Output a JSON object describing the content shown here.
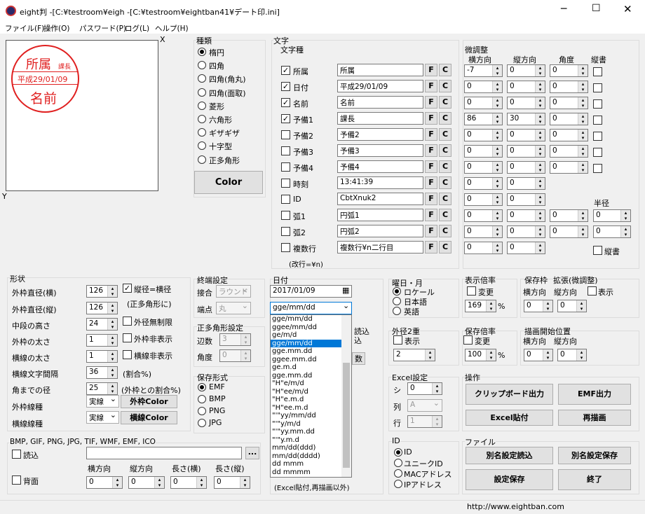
{
  "window": {
    "title": "eight判 -[C:¥testroom¥eigh -[C:¥testroom¥eightban41¥デート印.ini]"
  },
  "menu": [
    "ファイル(F)",
    "操作(O)",
    "パスワード(P)",
    "ログ(L)",
    "ヘルプ(H)"
  ],
  "canvas": {
    "x_label": "X",
    "y_label": "Y",
    "stamp": {
      "top": "所属",
      "badge": "課長",
      "date": "平成29/01/09",
      "name": "名前",
      "color": "#e02020"
    }
  },
  "shape": {
    "title": "種類",
    "options": [
      "楕円",
      "四角",
      "四角(角丸)",
      "四角(面取)",
      "菱形",
      "六角形",
      "ギザギザ",
      "十字型",
      "正多角形"
    ],
    "selected": 0,
    "color_button": "Color"
  },
  "text": {
    "title": "文字",
    "subtitle": "文字種",
    "note": "(改行=¥n)",
    "rows": [
      {
        "label": "所属",
        "checked": true,
        "value": "所属"
      },
      {
        "label": "日付",
        "checked": true,
        "value": "平成29/01/09"
      },
      {
        "label": "名前",
        "checked": true,
        "value": "名前"
      },
      {
        "label": "予備1",
        "checked": true,
        "value": "課長"
      },
      {
        "label": "予備2",
        "checked": false,
        "value": "予備2"
      },
      {
        "label": "予備3",
        "checked": false,
        "value": "予備3"
      },
      {
        "label": "予備4",
        "checked": false,
        "value": "予備4"
      },
      {
        "label": "時刻",
        "checked": false,
        "value": "13:41:39"
      },
      {
        "label": "ID",
        "checked": false,
        "value": "CbtXnuk2"
      },
      {
        "label": "弧1",
        "checked": false,
        "value": "円弧1"
      },
      {
        "label": "弧2",
        "checked": false,
        "value": "円弧2"
      },
      {
        "label": "複数行",
        "checked": false,
        "value": "複数行¥n二行目"
      }
    ],
    "f_label": "F",
    "c_label": "C"
  },
  "fine": {
    "title": "微調整",
    "headers": [
      "横方向",
      "縦方向",
      "角度",
      "縦書"
    ],
    "radius_label": "半径",
    "vertical_label": "縦書",
    "rows": [
      [
        "-7",
        "0",
        "0"
      ],
      [
        "0",
        "0",
        "0"
      ],
      [
        "0",
        "0",
        "0"
      ],
      [
        "86",
        "30",
        "0"
      ],
      [
        "0",
        "0",
        "0"
      ],
      [
        "0",
        "0",
        "0"
      ],
      [
        "0",
        "0",
        "0"
      ],
      [
        "0",
        "0",
        ""
      ],
      [
        "0",
        "0",
        ""
      ],
      [
        "0",
        "0",
        "0",
        "0"
      ],
      [
        "0",
        "0",
        "0",
        "0"
      ],
      [
        "0",
        "0",
        ""
      ]
    ]
  },
  "form": {
    "title": "形状",
    "labels": [
      "外枠直径(横)",
      "外枠直径(縦)",
      "中段の高さ",
      "外枠の太さ",
      "横線の太さ",
      "横線文字間隔",
      "角までの径",
      "外枠線種",
      "横線線種"
    ],
    "values": [
      "126",
      "126",
      "24",
      "1",
      "1",
      "36",
      "25"
    ],
    "line1": "実線",
    "line2": "実線",
    "checks": [
      "縦径=横径",
      "外径無制限",
      "外枠非表示",
      "横線非表示"
    ],
    "note1": "(正多角形に)",
    "note2": "(割合%)",
    "note3": "(外枠との割合%)",
    "btn_outer": "外枠Color",
    "btn_line": "横線Color"
  },
  "end": {
    "title": "終端設定",
    "join_label": "接合",
    "join_val": "ラウンド",
    "cap_label": "端点",
    "cap_val": "丸"
  },
  "poly": {
    "title": "正多角形設定",
    "sides_label": "辺数",
    "sides": "3",
    "angle_label": "角度",
    "angle": "0"
  },
  "save": {
    "title": "保存形式",
    "options": [
      "EMF",
      "BMP",
      "PNG",
      "JPG"
    ],
    "selected": 0
  },
  "date": {
    "title": "日付",
    "value": "2017/01/09",
    "format": "gge/mm/dd",
    "list": [
      "gge/mm/dd",
      "ggee/mm/dd",
      "ge/m/d",
      "gge/mm/dd",
      "gge.mm.dd",
      "ggee.mm.dd",
      "ge.m.d",
      "gge.mm.dd",
      "\"H\"e/m/d",
      "\"H\"ee/m/d",
      "\"H\"e.m.d",
      "\"H\"ee.m.d",
      "\"'\"yy/mm/dd",
      "\"'\"y/m/d",
      "\"'\"yy.mm.dd",
      "\"'\"y.m.d",
      "mm/dd(ddd)",
      "mm/dd(dddd)",
      "dd mmm",
      "dd mmmm"
    ],
    "selected": 3
  },
  "youbi": {
    "title": "曜日・月",
    "options": [
      "ロケール",
      "日本語",
      "英語"
    ],
    "selected": 0
  },
  "outer2": {
    "title": "外径2重",
    "show": "表示",
    "value": "2"
  },
  "partial": {
    "a": "読込",
    "b": "込",
    "c": "数"
  },
  "excel": {
    "title": "Excel設定",
    "sheet": "シ",
    "sheet_val": "0",
    "col": "列",
    "col_val": "A",
    "row": "行",
    "row_val": "1",
    "note": "(Excel貼付,再描画以外)"
  },
  "dispscale": {
    "title": "表示倍率",
    "change": "変更",
    "value": "169",
    "unit": "%"
  },
  "savescale": {
    "title": "保存倍率",
    "change": "変更",
    "value": "100",
    "unit": "%"
  },
  "savepos": {
    "title": "保存枠",
    "h": "横方向",
    "v": "縦方向",
    "hv": "0",
    "vv": "0"
  },
  "zoom": {
    "title": "拡張(微調整)",
    "v": "縦方向",
    "show": "表示",
    "vv": "0"
  },
  "drawpos": {
    "title": "描画開始位置",
    "h": "横方向",
    "v": "縦方向",
    "hv": "0",
    "vv": "0"
  },
  "ops": {
    "title": "操作",
    "buttons": [
      "クリップボード出力",
      "EMF出力",
      "Excel貼付",
      "再描画"
    ]
  },
  "file": {
    "title": "ファイル",
    "buttons": [
      "別名設定読込",
      "別名設定保存",
      "設定保存",
      "終了"
    ]
  },
  "id": {
    "title": "ID",
    "options": [
      "ID",
      "ユニークID",
      "MACアドレス",
      "IPアドレス"
    ],
    "selected": 0
  },
  "image": {
    "title": "BMP, GIF, PNG, JPG, TIF, WMF, EMF, ICO",
    "read": "読込",
    "bg": "背面",
    "browse": "...",
    "headers": [
      "横方向",
      "縦方向",
      "長さ(横)",
      "長さ(縦)"
    ],
    "values": [
      "0",
      "0",
      "0",
      "0"
    ]
  },
  "status": {
    "url": "http://www.eightban.com"
  }
}
